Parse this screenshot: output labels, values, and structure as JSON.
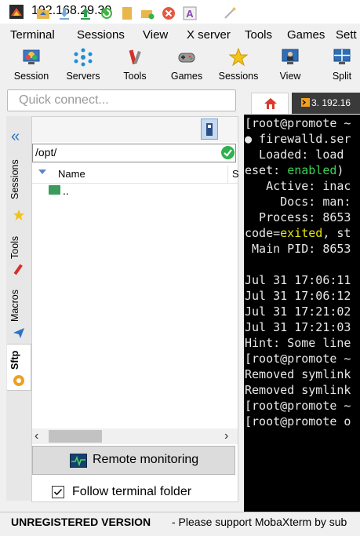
{
  "window": {
    "title": "192.168.29.30"
  },
  "menu": [
    "Terminal",
    "Sessions",
    "View",
    "X server",
    "Tools",
    "Games",
    "Sett"
  ],
  "toolbar": [
    "Session",
    "Servers",
    "Tools",
    "Games",
    "Sessions",
    "View",
    "Split"
  ],
  "quick_connect": {
    "placeholder": "Quick connect..."
  },
  "side_tabs": [
    "Sessions",
    "Tools",
    "Macros",
    "Sftp"
  ],
  "sftp": {
    "path": "/opt/",
    "columns": [
      "Name",
      "S"
    ],
    "rows": [
      ".."
    ],
    "remote_monitoring": "Remote monitoring",
    "follow_terminal_folder": "Follow terminal folder",
    "follow_checked": true
  },
  "tabs": {
    "session_tab": "3. 192.16"
  },
  "terminal": {
    "lines": [
      "[root@promote ~",
      "● firewalld.ser",
      "  Loaded: load",
      "eset: enabled)",
      "   Active: inac",
      "     Docs: man:",
      "  Process: 8653",
      "code=exited, st",
      " Main PID: 8653",
      "",
      "Jul 31 17:06:11",
      "Jul 31 17:06:12",
      "Jul 31 17:21:02",
      "Jul 31 17:21:03",
      "Hint: Some line",
      "[root@promote ~",
      "Removed symlink",
      "Removed symlink",
      "[root@promote ~",
      "[root@promote o"
    ]
  },
  "status": {
    "unregistered": "UNREGISTERED VERSION",
    "support": "-  Please support MobaXterm by sub"
  },
  "colors": {
    "accent": "#2b73c6",
    "terminal_bg": "#000000",
    "ok_green": "#2fb24b"
  }
}
